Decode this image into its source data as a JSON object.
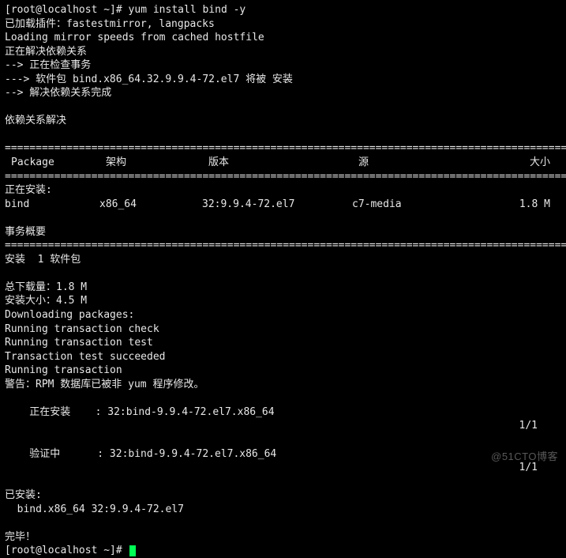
{
  "prompt1": "[root@localhost ~]# ",
  "cmd": "yum install bind -y",
  "l_plugins": "已加载插件：fastestmirror, langpacks",
  "l_loading": "Loading mirror speeds from cached hostfile",
  "l_resolve": "正在解决依赖关系",
  "l_check_trans": "--> 正在检查事务",
  "l_pkg_will": "---> 软件包 bind.x86_64.32.9.9.4-72.el7 将被 安装",
  "l_deps_done": "--> 解决依赖关系完成",
  "l_deps_resolved": "依赖关系解决",
  "hdr": {
    "pkg": "Package",
    "arch": "架构",
    "ver": "版本",
    "repo": "源",
    "size": "大小"
  },
  "l_installing_hdr": "正在安装:",
  "row": {
    "pkg": " bind",
    "arch": "x86_64",
    "ver": "32:9.9.4-72.el7",
    "repo": "c7-media",
    "size": "1.8 M"
  },
  "l_trans_summary": "事务概要",
  "l_install_count": "安装  1 软件包",
  "l_total_dl": "总下载量：1.8 M",
  "l_install_size": "安装大小：4.5 M",
  "l_dl": "Downloading packages:",
  "l_rtc": "Running transaction check",
  "l_rtt": "Running transaction test",
  "l_tts": "Transaction test succeeded",
  "l_rt": "Running transaction",
  "l_warn": "警告：RPM 数据库已被非 yum 程序修改。",
  "step_install": "  正在安装    : 32:bind-9.9.4-72.el7.x86_64",
  "step_verify": "  验证中      : 32:bind-9.9.4-72.el7.x86_64",
  "progress": "1/1",
  "l_installed": "已安装:",
  "l_installed_pkg": "  bind.x86_64 32:9.9.4-72.el7",
  "l_done": "完毕！",
  "prompt2": "[root@localhost ~]# ",
  "watermark": "@51CTO博客",
  "rule": "============================================================================================"
}
